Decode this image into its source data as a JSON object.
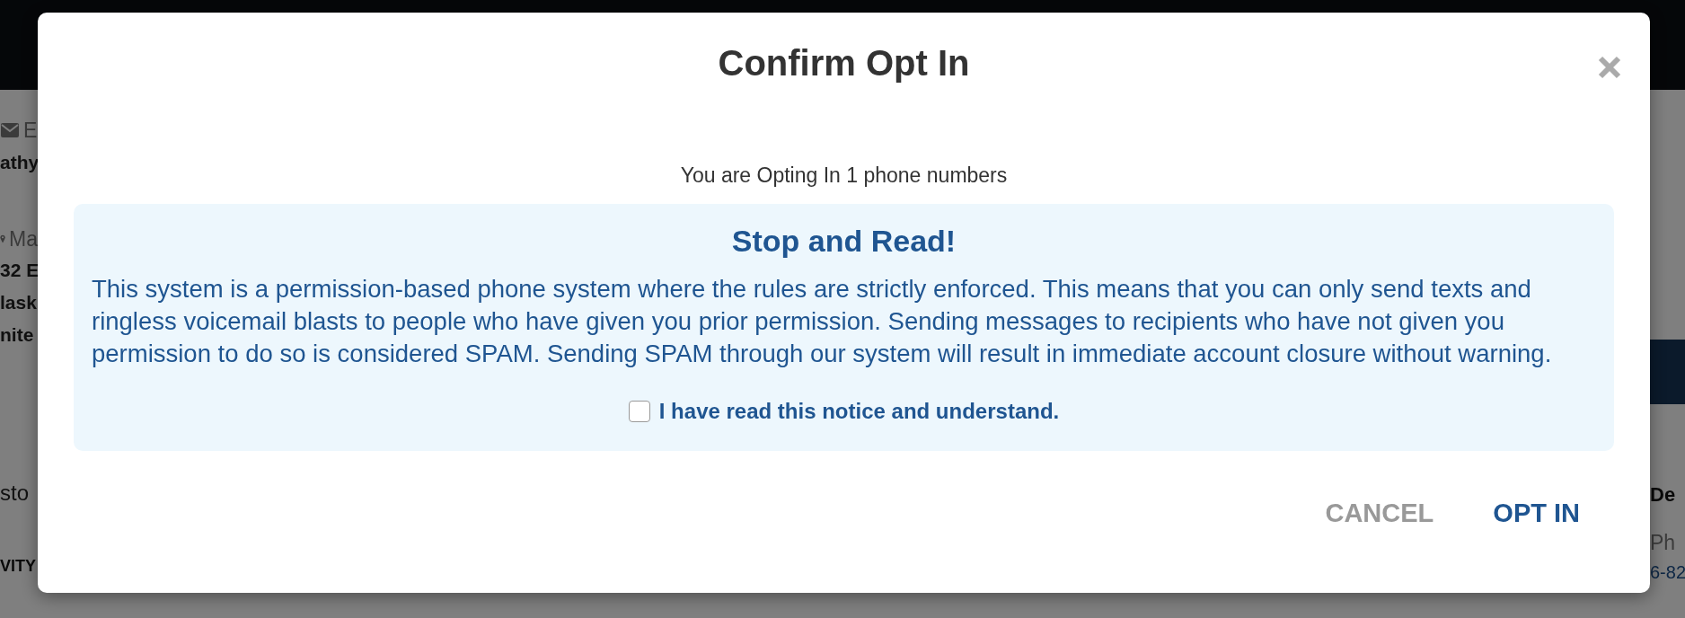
{
  "background": {
    "left_column": [
      {
        "kind": "email-label",
        "text": "E"
      },
      {
        "kind": "value",
        "text": "athy"
      },
      {
        "kind": "address-label",
        "text": "Ma"
      },
      {
        "kind": "value",
        "text": "32 E"
      },
      {
        "kind": "value",
        "text": "lask"
      },
      {
        "kind": "value",
        "text": "nite"
      },
      {
        "kind": "row",
        "text": "sto"
      },
      {
        "kind": "heading",
        "text": "VITY"
      }
    ],
    "right_column": [
      {
        "kind": "heading",
        "text": "De"
      },
      {
        "kind": "label",
        "text": "Ph"
      },
      {
        "kind": "link",
        "text": "6-82"
      }
    ]
  },
  "modal": {
    "title": "Confirm Opt In",
    "message": "You are Opting In 1 phone numbers",
    "alert": {
      "title": "Stop and Read!",
      "body": "This system is a permission-based phone system where the rules are strictly enforced. This means that you can only send texts and ringless voicemail blasts to people who have given you prior permission. Sending messages to recipients who have not given you permission to do so is considered SPAM. Sending SPAM through our system will result in immediate account closure without warning.",
      "checkbox": {
        "label": "I have read this notice and understand.",
        "checked": false
      }
    },
    "buttons": [
      {
        "label": "CANCEL",
        "kind": "secondary"
      },
      {
        "label": "OPT IN",
        "kind": "primary"
      }
    ]
  }
}
